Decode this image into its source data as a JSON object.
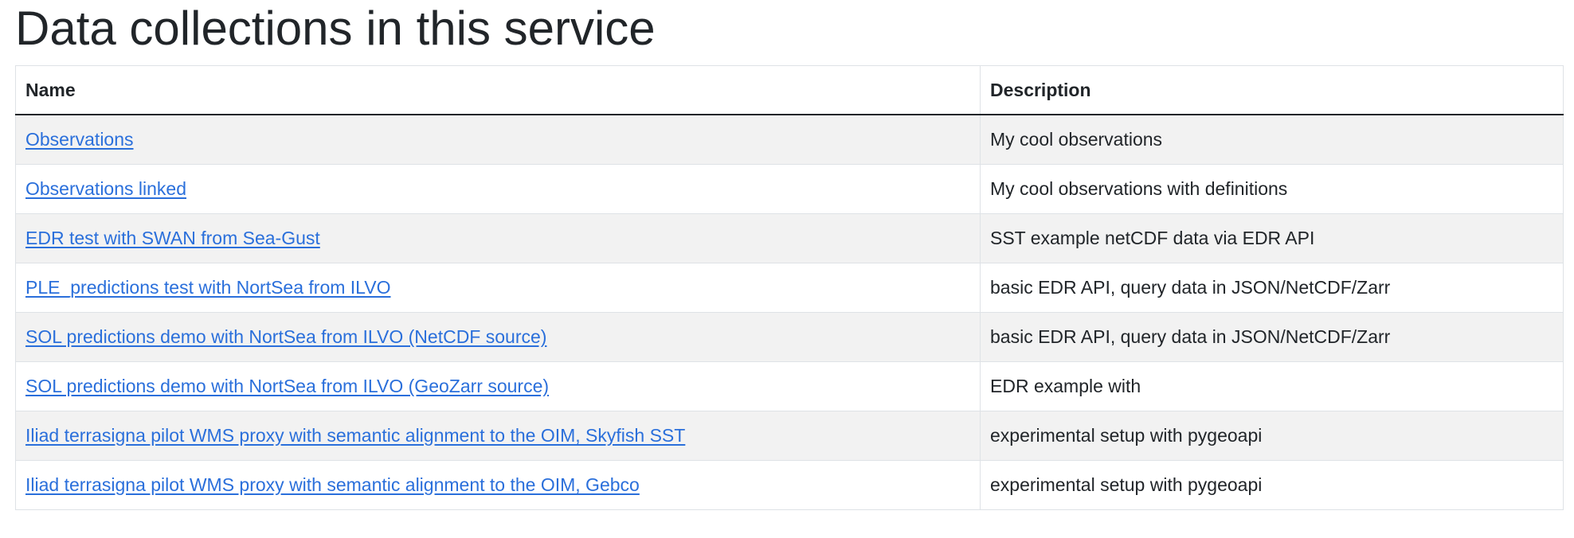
{
  "page": {
    "title": "Data collections in this service"
  },
  "table": {
    "headers": {
      "name": "Name",
      "description": "Description"
    },
    "rows": [
      {
        "name": "Observations",
        "description": "My cool observations"
      },
      {
        "name": "Observations linked",
        "description": "My cool observations with definitions"
      },
      {
        "name": "EDR test with SWAN from Sea-Gust",
        "description": "SST example netCDF data via EDR API"
      },
      {
        "name": "PLE_predictions test with NortSea from ILVO",
        "description": "basic EDR API, query data in JSON/NetCDF/Zarr"
      },
      {
        "name": "SOL predictions demo with NortSea from ILVO (NetCDF source)",
        "description": "basic EDR API, query data in JSON/NetCDF/Zarr"
      },
      {
        "name": "SOL predictions demo with NortSea from ILVO (GeoZarr source)",
        "description": "EDR example with"
      },
      {
        "name": "Iliad terrasigna pilot WMS proxy with semantic alignment to the OIM, Skyfish SST",
        "description": "experimental setup with pygeoapi"
      },
      {
        "name": "Iliad terrasigna pilot WMS proxy with semantic alignment to the OIM, Gebco",
        "description": "experimental setup with pygeoapi"
      }
    ]
  },
  "colors": {
    "link": "#2a6fdb",
    "text": "#212529",
    "stripe": "#f2f2f2",
    "border": "#dee2e6"
  }
}
